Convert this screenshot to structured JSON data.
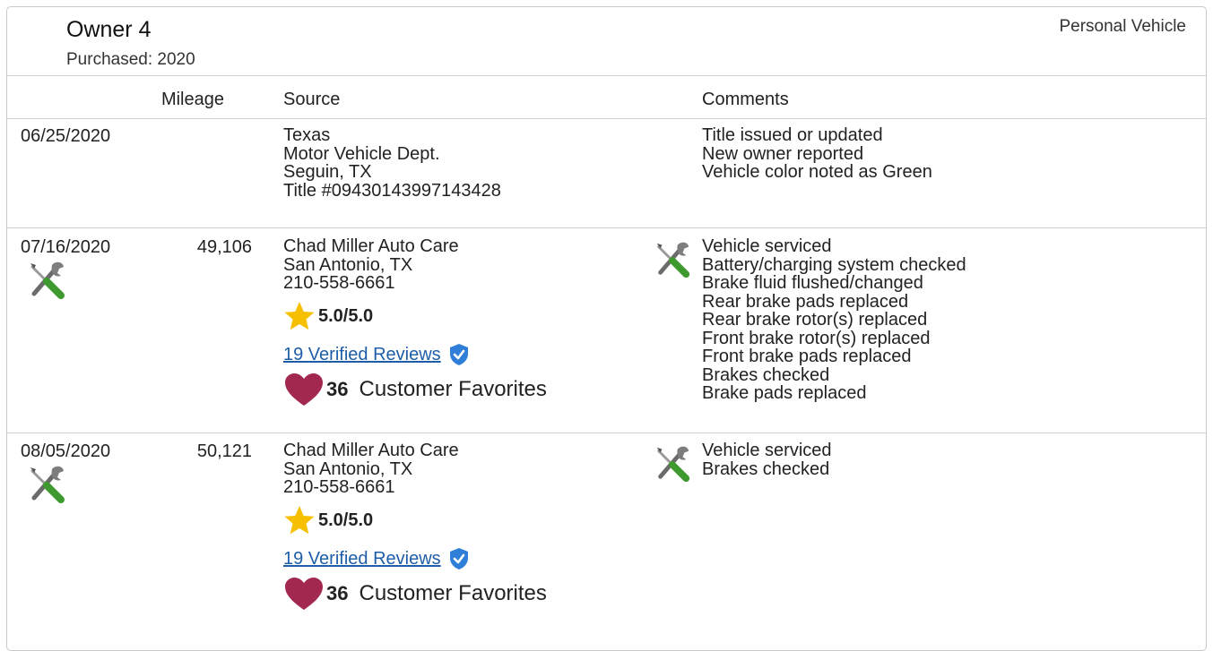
{
  "owner": {
    "title": "Owner 4",
    "purchased": "Purchased: 2020",
    "vehicle_type": "Personal Vehicle"
  },
  "columns": {
    "mileage": "Mileage",
    "source": "Source",
    "comments": "Comments"
  },
  "records": [
    {
      "date": "06/25/2020",
      "mileage": "",
      "source_lines": [
        "Texas",
        "Motor Vehicle Dept.",
        "Seguin, TX",
        "Title #09430143997143428"
      ],
      "comments": [
        "Title issued or updated",
        "New owner reported",
        "Vehicle color noted as Green"
      ]
    },
    {
      "date": "07/16/2020",
      "mileage": "49,106",
      "source_lines": [
        "Chad Miller Auto Care",
        "San Antonio, TX",
        "210-558-6661"
      ],
      "rating": "5.0/5.0",
      "reviews": "19 Verified Reviews",
      "favorites_count": "36",
      "favorites_label": "Customer Favorites",
      "comments": [
        "Vehicle serviced",
        "Battery/charging system checked",
        "Brake fluid flushed/changed",
        "Rear brake pads replaced",
        "Rear brake rotor(s) replaced",
        "Front brake rotor(s) replaced",
        "Front brake pads replaced",
        "Brakes checked",
        "Brake pads replaced"
      ]
    },
    {
      "date": "08/05/2020",
      "mileage": "50,121",
      "source_lines": [
        "Chad Miller Auto Care",
        "San Antonio, TX",
        "210-558-6661"
      ],
      "rating": "5.0/5.0",
      "reviews": "19 Verified Reviews",
      "favorites_count": "36",
      "favorites_label": "Customer Favorites",
      "comments": [
        "Vehicle serviced",
        "Brakes checked"
      ]
    }
  ],
  "icons": {
    "service": "wrench-screwdriver-icon",
    "rating": "star-icon",
    "verified": "verified-shield-icon",
    "favorites": "heart-icon"
  },
  "colors": {
    "star": "#f6c000",
    "heart": "#a3284f",
    "link": "#1e5ea8",
    "shield": "#2f7fd8"
  }
}
